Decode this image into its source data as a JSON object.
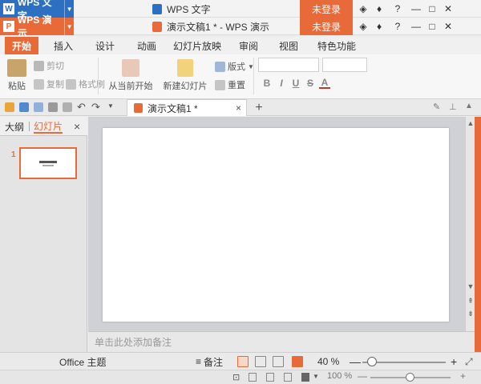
{
  "window1": {
    "app_label": "WPS 文字",
    "app_logo": "W",
    "doc_title": "WPS 文字",
    "login_label": "未登录"
  },
  "window2": {
    "app_label": "WPS 演示",
    "app_logo": "P",
    "doc_title": "演示文稿1 * - WPS 演示",
    "login_label": "未登录"
  },
  "window_controls": {
    "help": "?",
    "minimize": "—",
    "maximize": "□",
    "close": "✕"
  },
  "ribbon_tabs": [
    {
      "label": "开始",
      "active": true
    },
    {
      "label": "插入",
      "active": false
    },
    {
      "label": "设计",
      "active": false
    },
    {
      "label": "动画",
      "active": false
    },
    {
      "label": "幻灯片放映",
      "active": false
    },
    {
      "label": "审阅",
      "active": false
    },
    {
      "label": "视图",
      "active": false
    },
    {
      "label": "特色功能",
      "active": false
    }
  ],
  "ribbon": {
    "paste": "粘贴",
    "cut": "剪切",
    "copy": "复制",
    "format_painter": "格式刷",
    "from_current": "从当前开始",
    "new_slide": "新建幻灯片",
    "layout": "版式",
    "reset": "重置",
    "bold": "B",
    "italic": "I",
    "underline": "U",
    "strike": "S",
    "font_color": "A"
  },
  "doc_tab": {
    "label": "演示文稿1 *",
    "close": "×",
    "add": "+"
  },
  "left_panel": {
    "tab_outline": "大纲",
    "tab_slides": "幻灯片",
    "close": "×",
    "slide_number": "1"
  },
  "notes_placeholder": "单击此处添加备注",
  "status": {
    "theme": "Office 主题",
    "notes_btn": "备注",
    "zoom_value": "40 %",
    "zoom_fraction": 0.4,
    "zoom2_value": "100 %",
    "zoom2_fraction": 0.5,
    "minus": "—",
    "plus": "+"
  },
  "colors": {
    "accent": "#e96a39",
    "wps_writer_blue": "#2d6fc0"
  }
}
